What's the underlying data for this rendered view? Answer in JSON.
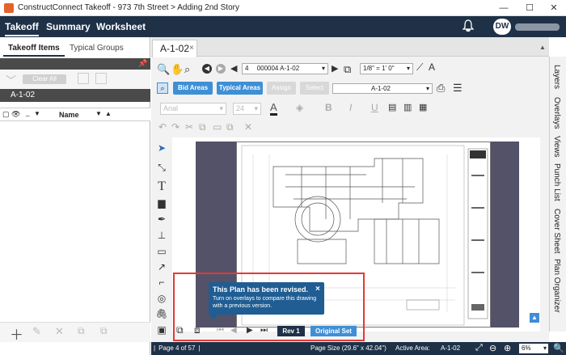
{
  "window": {
    "title": "ConstructConnect Takeoff - 973 7th Street > Adding 2nd Story",
    "minimize": "—",
    "maximize": "☐",
    "close": "✕"
  },
  "menu": {
    "items": [
      "Takeoff",
      "Summary",
      "Worksheet"
    ],
    "user_initials": "DW"
  },
  "left_panel": {
    "tabs": [
      "Takeoff Items",
      "Typical Groups"
    ],
    "clear_all": "Clear All",
    "selected_item": "A-1-02",
    "columns": {
      "underscore": "_",
      "name": "Name"
    }
  },
  "document_tab": {
    "label": "A-1-02",
    "close": "×"
  },
  "toolbar": {
    "page_number": "4",
    "page_select": "000004 A-1-02",
    "scale": "1/8\" = 1' 0\"",
    "bid_areas": "Bid Areas",
    "typical_areas": "Typical Areas",
    "assign": "Assign",
    "select": "Select",
    "sheet_select": "A-1-02",
    "font_family": "Arial",
    "font_size": "24",
    "bold": "B",
    "italic": "I",
    "underline": "U",
    "font_color_glyph": "A"
  },
  "right_tabs": [
    "Layers",
    "Overlays",
    "Views",
    "Punch List",
    "Cover Sheet",
    "Plan Organizer"
  ],
  "revision_popup": {
    "title": "This Plan has been revised.",
    "body": "Turn on overlays to compare this drawing with a previous version.",
    "close": "×"
  },
  "revision_controls": {
    "rev_button": "Rev 1",
    "original_set_button": "Original Set"
  },
  "status_bar": {
    "page": "Page 4 of 57",
    "page_size": "Page Size (29.6\" x 42.04\")",
    "active_area_label": "Active Area:",
    "active_area_value": "A-1-02",
    "zoom": "6%"
  },
  "colors": {
    "brand_navy": "#1e3147",
    "accent_blue": "#3f8fd6",
    "popup_blue": "#1f5d93",
    "highlight_red": "#e53935"
  }
}
